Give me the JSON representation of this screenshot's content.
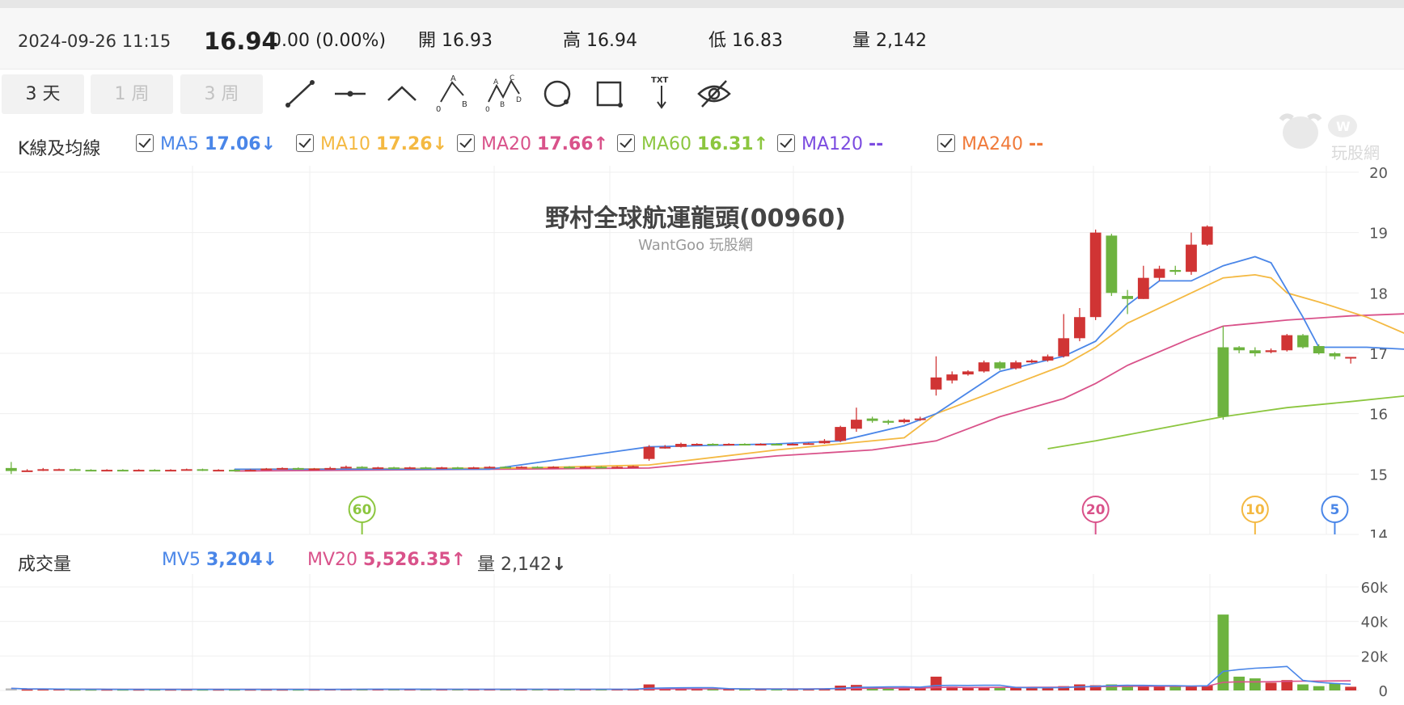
{
  "quote": {
    "datetime": "2024-09-26 11:15",
    "price": "16.94",
    "change": "0.00 (0.00%)",
    "open_label": "開 16.93",
    "high_label": "高 16.94",
    "low_label": "低 16.83",
    "volume_label": "量 2,142"
  },
  "ranges": [
    "3 天",
    "1 周",
    "3 周"
  ],
  "legend": {
    "title": "K線及均線",
    "ma5_label": "MA5",
    "ma5_value": "17.06",
    "ma5_arrow": "↓",
    "ma10_label": "MA10",
    "ma10_value": "17.26",
    "ma10_arrow": "↓",
    "ma20_label": "MA20",
    "ma20_value": "17.66",
    "ma20_arrow": "↑",
    "ma60_label": "MA60",
    "ma60_value": "16.31",
    "ma60_arrow": "↑",
    "ma120_label": "MA120",
    "ma120_value": "--",
    "ma240_label": "MA240",
    "ma240_value": "--"
  },
  "volume_legend": {
    "title": "成交量",
    "mv5_label": "MV5",
    "mv5_value": "3,204",
    "mv5_arrow": "↓",
    "mv20_label": "MV20",
    "mv20_value": "5,526.35",
    "mv20_arrow": "↑",
    "vol_label": "量",
    "vol_value": "2,142",
    "vol_arrow": "↓"
  },
  "watermark_text": "玩股網",
  "colors": {
    "up": "#d03434",
    "down": "#6db33f",
    "ma5": "#4a86e8",
    "ma10": "#f4b942",
    "ma20": "#d9528a",
    "ma60": "#8cc63f",
    "ma120": "#7b4be0",
    "ma240": "#f07a3a"
  },
  "chart_data": {
    "type": "candlestick",
    "title": "野村全球航運龍頭(00960)",
    "subtitle": "WantGoo 玩股網",
    "price_axis": {
      "ylim": [
        14,
        20
      ],
      "ticks": [
        14,
        15,
        16,
        17,
        18,
        19,
        20
      ]
    },
    "volume_axis": {
      "ylim": [
        0,
        60000
      ],
      "ticks": [
        "0",
        "20k",
        "40k",
        "60k"
      ]
    },
    "ma_markers": [
      {
        "label": "60",
        "color": "#8cc63f",
        "index": 22
      },
      {
        "label": "20",
        "color": "#d9528a",
        "index": 68
      },
      {
        "label": "10",
        "color": "#f4b942",
        "index": 78
      },
      {
        "label": "5",
        "color": "#4a86e8",
        "index": 83
      }
    ],
    "candles": [
      [
        15.1,
        15.05,
        15.2,
        15.0
      ],
      [
        15.05,
        15.06,
        15.08,
        15.04
      ],
      [
        15.06,
        15.08,
        15.1,
        15.05
      ],
      [
        15.07,
        15.08,
        15.09,
        15.06
      ],
      [
        15.08,
        15.07,
        15.09,
        15.06
      ],
      [
        15.07,
        15.06,
        15.08,
        15.05
      ],
      [
        15.06,
        15.07,
        15.08,
        15.05
      ],
      [
        15.07,
        15.06,
        15.08,
        15.05
      ],
      [
        15.06,
        15.07,
        15.08,
        15.05
      ],
      [
        15.07,
        15.06,
        15.08,
        15.05
      ],
      [
        15.06,
        15.07,
        15.08,
        15.05
      ],
      [
        15.07,
        15.08,
        15.09,
        15.06
      ],
      [
        15.08,
        15.06,
        15.09,
        15.05
      ],
      [
        15.06,
        15.07,
        15.08,
        15.05
      ],
      [
        15.07,
        15.06,
        15.08,
        15.05
      ],
      [
        15.06,
        15.07,
        15.08,
        15.05
      ],
      [
        15.08,
        15.09,
        15.1,
        15.07
      ],
      [
        15.09,
        15.1,
        15.11,
        15.08
      ],
      [
        15.1,
        15.08,
        15.11,
        15.07
      ],
      [
        15.08,
        15.09,
        15.1,
        15.07
      ],
      [
        15.09,
        15.1,
        15.12,
        15.08
      ],
      [
        15.1,
        15.12,
        15.14,
        15.09
      ],
      [
        15.12,
        15.1,
        15.13,
        15.09
      ],
      [
        15.1,
        15.11,
        15.12,
        15.09
      ],
      [
        15.11,
        15.1,
        15.12,
        15.09
      ],
      [
        15.1,
        15.11,
        15.12,
        15.09
      ],
      [
        15.11,
        15.1,
        15.12,
        15.09
      ],
      [
        15.1,
        15.11,
        15.12,
        15.09
      ],
      [
        15.11,
        15.1,
        15.12,
        15.09
      ],
      [
        15.1,
        15.11,
        15.12,
        15.09
      ],
      [
        15.11,
        15.12,
        15.13,
        15.1
      ],
      [
        15.12,
        15.11,
        15.13,
        15.1
      ],
      [
        15.11,
        15.12,
        15.13,
        15.1
      ],
      [
        15.12,
        15.11,
        15.13,
        15.1
      ],
      [
        15.11,
        15.12,
        15.13,
        15.1
      ],
      [
        15.12,
        15.11,
        15.13,
        15.1
      ],
      [
        15.11,
        15.12,
        15.13,
        15.1
      ],
      [
        15.12,
        15.11,
        15.13,
        15.1
      ],
      [
        15.11,
        15.12,
        15.13,
        15.1
      ],
      [
        15.12,
        15.13,
        15.14,
        15.11
      ],
      [
        15.25,
        15.45,
        15.48,
        15.22
      ],
      [
        15.43,
        15.45,
        15.48,
        15.42
      ],
      [
        15.45,
        15.5,
        15.52,
        15.44
      ],
      [
        15.49,
        15.5,
        15.51,
        15.48
      ],
      [
        15.5,
        15.49,
        15.51,
        15.48
      ],
      [
        15.49,
        15.5,
        15.51,
        15.48
      ],
      [
        15.5,
        15.49,
        15.51,
        15.48
      ],
      [
        15.49,
        15.5,
        15.51,
        15.48
      ],
      [
        15.5,
        15.49,
        15.51,
        15.48
      ],
      [
        15.49,
        15.5,
        15.51,
        15.48
      ],
      [
        15.5,
        15.51,
        15.52,
        15.49
      ],
      [
        15.51,
        15.55,
        15.58,
        15.5
      ],
      [
        15.55,
        15.78,
        15.8,
        15.53
      ],
      [
        15.75,
        15.9,
        16.1,
        15.7
      ],
      [
        15.92,
        15.88,
        15.95,
        15.85
      ],
      [
        15.88,
        15.85,
        15.9,
        15.82
      ],
      [
        15.86,
        15.9,
        15.92,
        15.84
      ],
      [
        15.9,
        15.92,
        15.95,
        15.88
      ],
      [
        16.4,
        16.6,
        16.95,
        16.3
      ],
      [
        16.55,
        16.65,
        16.7,
        16.5
      ],
      [
        16.65,
        16.7,
        16.72,
        16.63
      ],
      [
        16.7,
        16.85,
        16.88,
        16.68
      ],
      [
        16.85,
        16.75,
        16.87,
        16.72
      ],
      [
        16.75,
        16.85,
        16.88,
        16.73
      ],
      [
        16.85,
        16.88,
        16.9,
        16.84
      ],
      [
        16.88,
        16.95,
        16.98,
        16.86
      ],
      [
        16.95,
        17.25,
        17.65,
        16.93
      ],
      [
        17.25,
        17.6,
        17.75,
        17.2
      ],
      [
        17.6,
        19.0,
        19.05,
        17.55
      ],
      [
        18.95,
        18.0,
        18.98,
        17.95
      ],
      [
        17.95,
        17.9,
        18.05,
        17.65
      ],
      [
        17.9,
        18.25,
        18.45,
        17.9
      ],
      [
        18.25,
        18.4,
        18.45,
        18.2
      ],
      [
        18.38,
        18.35,
        18.45,
        18.3
      ],
      [
        18.35,
        18.8,
        19.0,
        18.3
      ],
      [
        18.8,
        19.1,
        19.12,
        18.78
      ],
      [
        17.1,
        15.95,
        17.45,
        15.9
      ],
      [
        17.1,
        17.05,
        17.12,
        17.0
      ],
      [
        17.05,
        17.0,
        17.1,
        16.95
      ],
      [
        17.02,
        17.05,
        17.08,
        17.0
      ],
      [
        17.05,
        17.3,
        17.32,
        17.03
      ],
      [
        17.3,
        17.1,
        17.32,
        17.08
      ],
      [
        17.12,
        17.0,
        17.15,
        16.98
      ],
      [
        17.0,
        16.95,
        17.02,
        16.9
      ],
      [
        16.93,
        16.94,
        16.94,
        16.83
      ]
    ],
    "volumes": [
      1200,
      600,
      700,
      700,
      600,
      600,
      600,
      600,
      600,
      600,
      600,
      600,
      600,
      600,
      600,
      600,
      600,
      600,
      600,
      600,
      700,
      800,
      900,
      700,
      700,
      700,
      700,
      700,
      700,
      700,
      700,
      700,
      700,
      700,
      700,
      700,
      700,
      700,
      700,
      800,
      3500,
      1500,
      1200,
      900,
      800,
      800,
      800,
      800,
      800,
      800,
      900,
      1100,
      2800,
      3200,
      1700,
      1600,
      1500,
      1500,
      8000,
      2200,
      1400,
      2000,
      1600,
      1400,
      1500,
      1400,
      2500,
      3500,
      3000,
      3500,
      2500,
      2200,
      2800,
      3000,
      2500,
      3000,
      44000,
      8000,
      7000,
      4500,
      6000,
      3500,
      2500,
      4000,
      2142
    ],
    "ma5": [
      [
        14,
        15.08
      ],
      [
        30,
        15.08
      ],
      [
        40,
        15.45
      ],
      [
        48,
        15.5
      ],
      [
        52,
        15.55
      ],
      [
        56,
        15.8
      ],
      [
        58,
        16.0
      ],
      [
        62,
        16.7
      ],
      [
        66,
        16.95
      ],
      [
        68,
        17.2
      ],
      [
        70,
        17.8
      ],
      [
        72,
        18.2
      ],
      [
        74,
        18.2
      ],
      [
        76,
        18.45
      ],
      [
        78,
        18.6
      ],
      [
        79,
        18.5
      ],
      [
        81,
        17.6
      ],
      [
        82,
        17.1
      ],
      [
        85,
        17.1
      ],
      [
        88,
        17.06
      ]
    ],
    "ma10": [
      [
        14,
        15.08
      ],
      [
        32,
        15.1
      ],
      [
        40,
        15.15
      ],
      [
        48,
        15.4
      ],
      [
        52,
        15.5
      ],
      [
        56,
        15.6
      ],
      [
        58,
        16.0
      ],
      [
        62,
        16.4
      ],
      [
        66,
        16.8
      ],
      [
        68,
        17.1
      ],
      [
        70,
        17.5
      ],
      [
        74,
        18.0
      ],
      [
        76,
        18.25
      ],
      [
        78,
        18.3
      ],
      [
        79,
        18.25
      ],
      [
        80,
        18.0
      ],
      [
        82,
        17.85
      ],
      [
        85,
        17.6
      ],
      [
        88,
        17.26
      ]
    ],
    "ma20": [
      [
        14,
        15.05
      ],
      [
        30,
        15.08
      ],
      [
        40,
        15.1
      ],
      [
        48,
        15.3
      ],
      [
        54,
        15.4
      ],
      [
        58,
        15.55
      ],
      [
        62,
        15.95
      ],
      [
        66,
        16.25
      ],
      [
        68,
        16.5
      ],
      [
        70,
        16.8
      ],
      [
        74,
        17.25
      ],
      [
        76,
        17.45
      ],
      [
        78,
        17.5
      ],
      [
        80,
        17.55
      ],
      [
        84,
        17.62
      ],
      [
        88,
        17.66
      ]
    ],
    "ma60": [
      [
        65,
        15.42
      ],
      [
        68,
        15.55
      ],
      [
        72,
        15.75
      ],
      [
        76,
        15.95
      ],
      [
        80,
        16.1
      ],
      [
        84,
        16.2
      ],
      [
        88,
        16.31
      ]
    ]
  }
}
